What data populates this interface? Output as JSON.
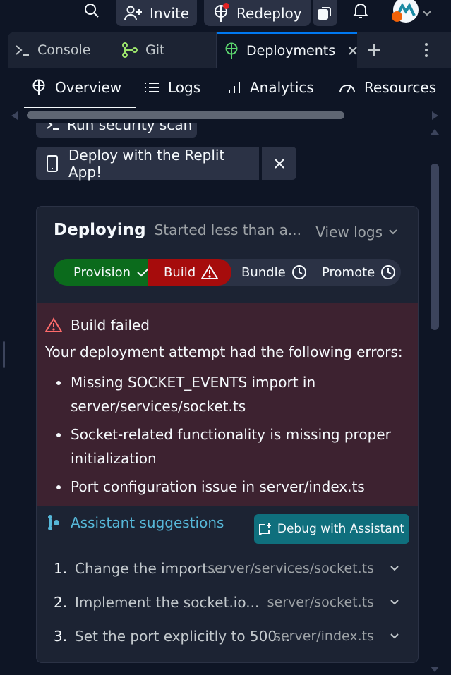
{
  "topbar": {
    "invite_label": "Invite",
    "redeploy_label": "Redeploy",
    "icons": [
      "search-icon",
      "add-user-icon",
      "deploy-icon",
      "copy-icon",
      "bell-icon",
      "avatar",
      "chevron-down-icon"
    ]
  },
  "tabs": [
    {
      "label": "Console",
      "icon": "terminal-icon"
    },
    {
      "label": "Git",
      "icon": "git-icon"
    },
    {
      "label": "Deployments",
      "icon": "deploy-icon",
      "active": true
    }
  ],
  "subnav": [
    {
      "label": "Overview",
      "icon": "globe-icon",
      "active": true
    },
    {
      "label": "Logs",
      "icon": "list-icon"
    },
    {
      "label": "Analytics",
      "icon": "bar-chart-icon"
    },
    {
      "label": "Resources",
      "icon": "gauge-icon"
    }
  ],
  "content": {
    "partial_button_label": "Run security scan",
    "replit_app_label": "Deploy with the Replit App!",
    "status_title": "Deploying",
    "status_sub": "Started less than a...",
    "view_logs_label": "View logs",
    "steps": [
      {
        "label": "Provision",
        "state": "done"
      },
      {
        "label": "Build",
        "state": "failed"
      },
      {
        "label": "Bundle",
        "state": "pending"
      },
      {
        "label": "Promote",
        "state": "pending"
      }
    ],
    "error": {
      "title": "Build failed",
      "description": "Your deployment attempt had the following errors:",
      "items": [
        "Missing SOCKET_EVENTS import in server/services/socket.ts",
        "Socket-related functionality is missing proper initialization",
        "Port configuration issue in server/index.ts"
      ]
    },
    "assistant": {
      "title": "Assistant suggestions",
      "debug_label": "Debug with Assistant",
      "suggestions": [
        {
          "num": "1.",
          "text": "Change the import ...",
          "file": "server/services/socket.ts"
        },
        {
          "num": "2.",
          "text": "Implement the socket.io...",
          "file": "server/socket.ts"
        },
        {
          "num": "3.",
          "text": "Set the port explicitly to 500...",
          "file": "server/index.ts"
        }
      ]
    }
  },
  "colors": {
    "background": "#0e1525",
    "surface": "#1c2333",
    "chip": "#2b3245",
    "success": "#0b6b1c",
    "error": "#a60c0c",
    "error_bg": "#3d2230",
    "assistant_accent": "#56b7d8",
    "debug_button": "#0f6f7d",
    "active_tab": "#0079f2"
  }
}
